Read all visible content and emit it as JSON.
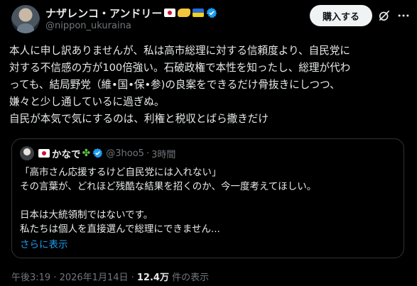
{
  "author": {
    "display_name": "ナザレンコ・アンドリー",
    "handle": "@nippon_ukuraina",
    "badges": [
      "flag-japan-icon",
      "handshake-icon",
      "flag-ukraine-icon",
      "verified-icon"
    ]
  },
  "actions": {
    "subscribe_label": "購入する"
  },
  "post": {
    "text": "本人に申し訳ありませんが、私は高市総理に対する信頼度より、自民党に\n対する不信感の方が100倍強い。石破政権で本性を知ったし、総理が代わ\nっても、結局野党（維•国•保•参)の良案をできるだけ骨抜きにしつつ、\n嫌々と少し通しているに過ぎぬ。\n自民が本気で気にするのは、利権と税収とばら撒きだけ"
  },
  "quote": {
    "name": "かなで",
    "handle": "@3hoo5",
    "dot": "·",
    "time": "3時間",
    "text": "「高市さん応援するけど自民党には入れない」\nその言葉が、どれほど残酷な結果を招くのか、今一度考えてほしい。\n\n日本は大統領制ではないです。\n私たちは個人を直接選んで総理にできません...",
    "show_more": "さらに表示"
  },
  "meta": {
    "timestamp": "午後3:19 · 2026年1月14日 · ",
    "views": "12.4万",
    "views_label": " 件の表示"
  },
  "colors": {
    "background": "#000000",
    "text": "#e7e9ea",
    "muted": "#71767b",
    "link": "#1d9bf0",
    "verified": "#1d9bf0"
  }
}
